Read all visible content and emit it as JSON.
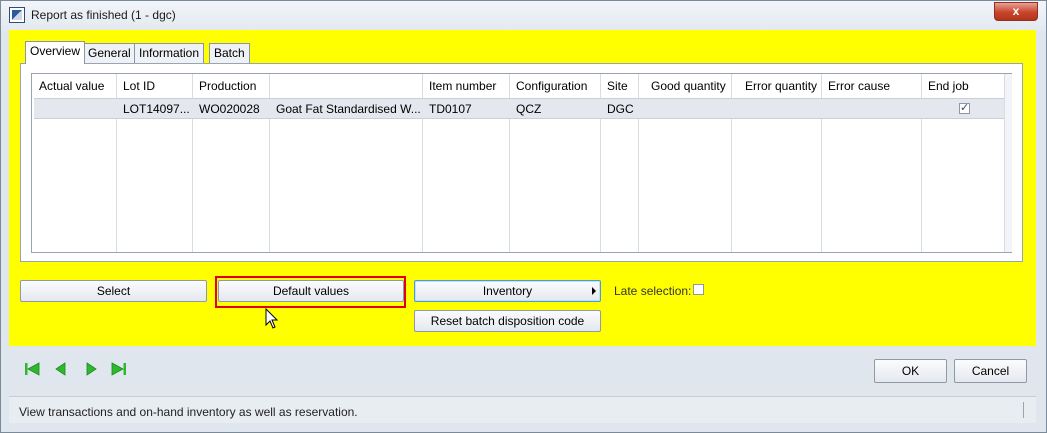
{
  "window": {
    "title": "Report as finished (1 - dgc)",
    "close_glyph": "x"
  },
  "tabs": [
    {
      "label": "Overview",
      "active": true
    },
    {
      "label": "General",
      "active": false
    },
    {
      "label": "Information",
      "active": false
    },
    {
      "label": "Batch",
      "active": false
    }
  ],
  "grid": {
    "columns": [
      "Actual value",
      "Lot ID",
      "Production",
      "",
      "Item number",
      "Configuration",
      "Site",
      "Good quantity",
      "Error quantity",
      "Error cause",
      "End job"
    ],
    "rows": [
      {
        "actual_value": "",
        "lot_id": "LOT14097...",
        "production": "WO020028",
        "name": "Goat Fat Standardised W...",
        "item_number": "TD0107",
        "configuration": "QCZ",
        "site": "DGC",
        "good_quantity": "",
        "error_quantity": "",
        "error_cause": "",
        "end_job": true
      }
    ]
  },
  "actions": {
    "select": "Select",
    "default_values": "Default values",
    "inventory": "Inventory",
    "late_selection": "Late selection:",
    "reset_batch": "Reset batch disposition code"
  },
  "footer": {
    "ok": "OK",
    "cancel": "Cancel"
  },
  "status_bar": "View transactions and on-hand inventory as well as reservation.",
  "colors": {
    "panel_background": "#ffff00",
    "highlight_border": "#e0001a",
    "nav_icon": "#2fb82f"
  },
  "icons": [
    "first-record-icon",
    "previous-record-icon",
    "next-record-icon",
    "last-record-icon"
  ]
}
